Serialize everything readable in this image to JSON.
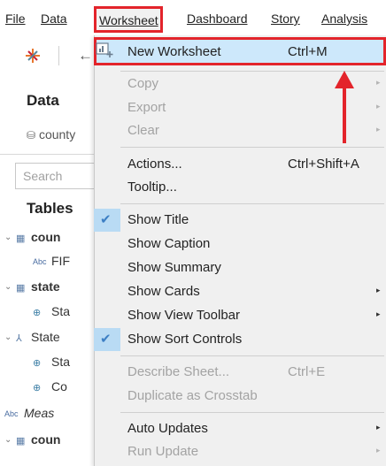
{
  "menubar": {
    "items": [
      "File",
      "Data",
      "Worksheet",
      "Dashboard",
      "Story",
      "Analysis"
    ]
  },
  "left_panel": {
    "data_heading": "Data",
    "datasource": "county",
    "search_placeholder": "Search",
    "tables_heading": "Tables",
    "tree": [
      {
        "label": "coun",
        "bold": true
      },
      {
        "label": "FIF"
      },
      {
        "label": "state",
        "bold": true
      },
      {
        "label": "Sta"
      },
      {
        "label": "State"
      },
      {
        "label": "Sta"
      },
      {
        "label": "Co"
      },
      {
        "label": "Meas",
        "italic": true
      },
      {
        "label": "coun",
        "bold": true
      }
    ]
  },
  "menu": {
    "new_worksheet": {
      "label": "New Worksheet",
      "shortcut": "Ctrl+M"
    },
    "copy": "Copy",
    "export": "Export",
    "clear": "Clear",
    "actions": {
      "label": "Actions...",
      "shortcut": "Ctrl+Shift+A"
    },
    "tooltip": "Tooltip...",
    "show_title": "Show Title",
    "show_caption": "Show Caption",
    "show_summary": "Show Summary",
    "show_cards": "Show Cards",
    "show_view_toolbar": "Show View Toolbar",
    "show_sort_controls": "Show Sort Controls",
    "describe_sheet": {
      "label": "Describe Sheet...",
      "shortcut": "Ctrl+E"
    },
    "duplicate_crosstab": "Duplicate as Crosstab",
    "auto_updates": "Auto Updates",
    "run_update": "Run Update"
  },
  "icons": {
    "checkmark": "checkmark-icon",
    "submenu": "submenu-arrow-icon",
    "new_worksheet": "new-worksheet-icon"
  },
  "colors": {
    "highlight_border": "#e3242b",
    "highlight_fill": "#cde8fb",
    "check_column": "#b9dbf4",
    "annotation_arrow": "#e3242b"
  }
}
